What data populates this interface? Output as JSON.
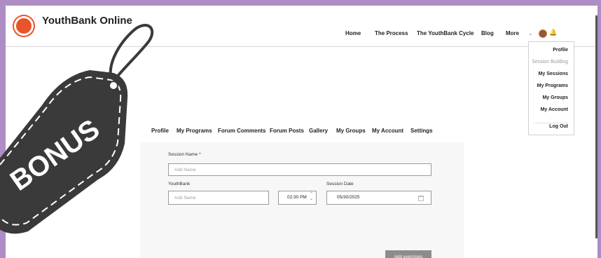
{
  "brand": {
    "name": "YouthBank Online",
    "logo_color": "#e9542a"
  },
  "nav": {
    "items": [
      {
        "label": "Home"
      },
      {
        "label": "The Process"
      },
      {
        "label": "The YouthBank Cycle"
      },
      {
        "label": "Blog"
      },
      {
        "label": "More"
      }
    ]
  },
  "user_menu": {
    "items": [
      {
        "label": "Profile",
        "muted": false
      },
      {
        "label": "Session Building",
        "muted": true
      },
      {
        "label": "My Sessions",
        "muted": false
      },
      {
        "label": "My Programs",
        "muted": false
      },
      {
        "label": "My Groups",
        "muted": false
      },
      {
        "label": "My Account",
        "muted": false
      }
    ],
    "logout": "Log Out"
  },
  "profile_tabs": [
    {
      "label": "Profile"
    },
    {
      "label": "My Programs"
    },
    {
      "label": "Forum Comments"
    },
    {
      "label": "Forum Posts"
    },
    {
      "label": "Gallery"
    },
    {
      "label": "My Groups"
    },
    {
      "label": "My Account"
    },
    {
      "label": "Settings"
    }
  ],
  "form": {
    "session_name_label": "Session Name *",
    "session_name_placeholder": "Add Name",
    "youthbank_label": "YouthBank",
    "youthbank_placeholder": "Add Name",
    "time_value": "02:30 PM",
    "session_date_label": "Session Date",
    "session_date_value": "05/30/2025",
    "add_button": "Add exercises"
  },
  "overlay": {
    "tag_text": "BONUS"
  },
  "colors": {
    "background": "#ae8cc4",
    "tag": "#3a3a3a",
    "button": "#8c8c8c"
  }
}
